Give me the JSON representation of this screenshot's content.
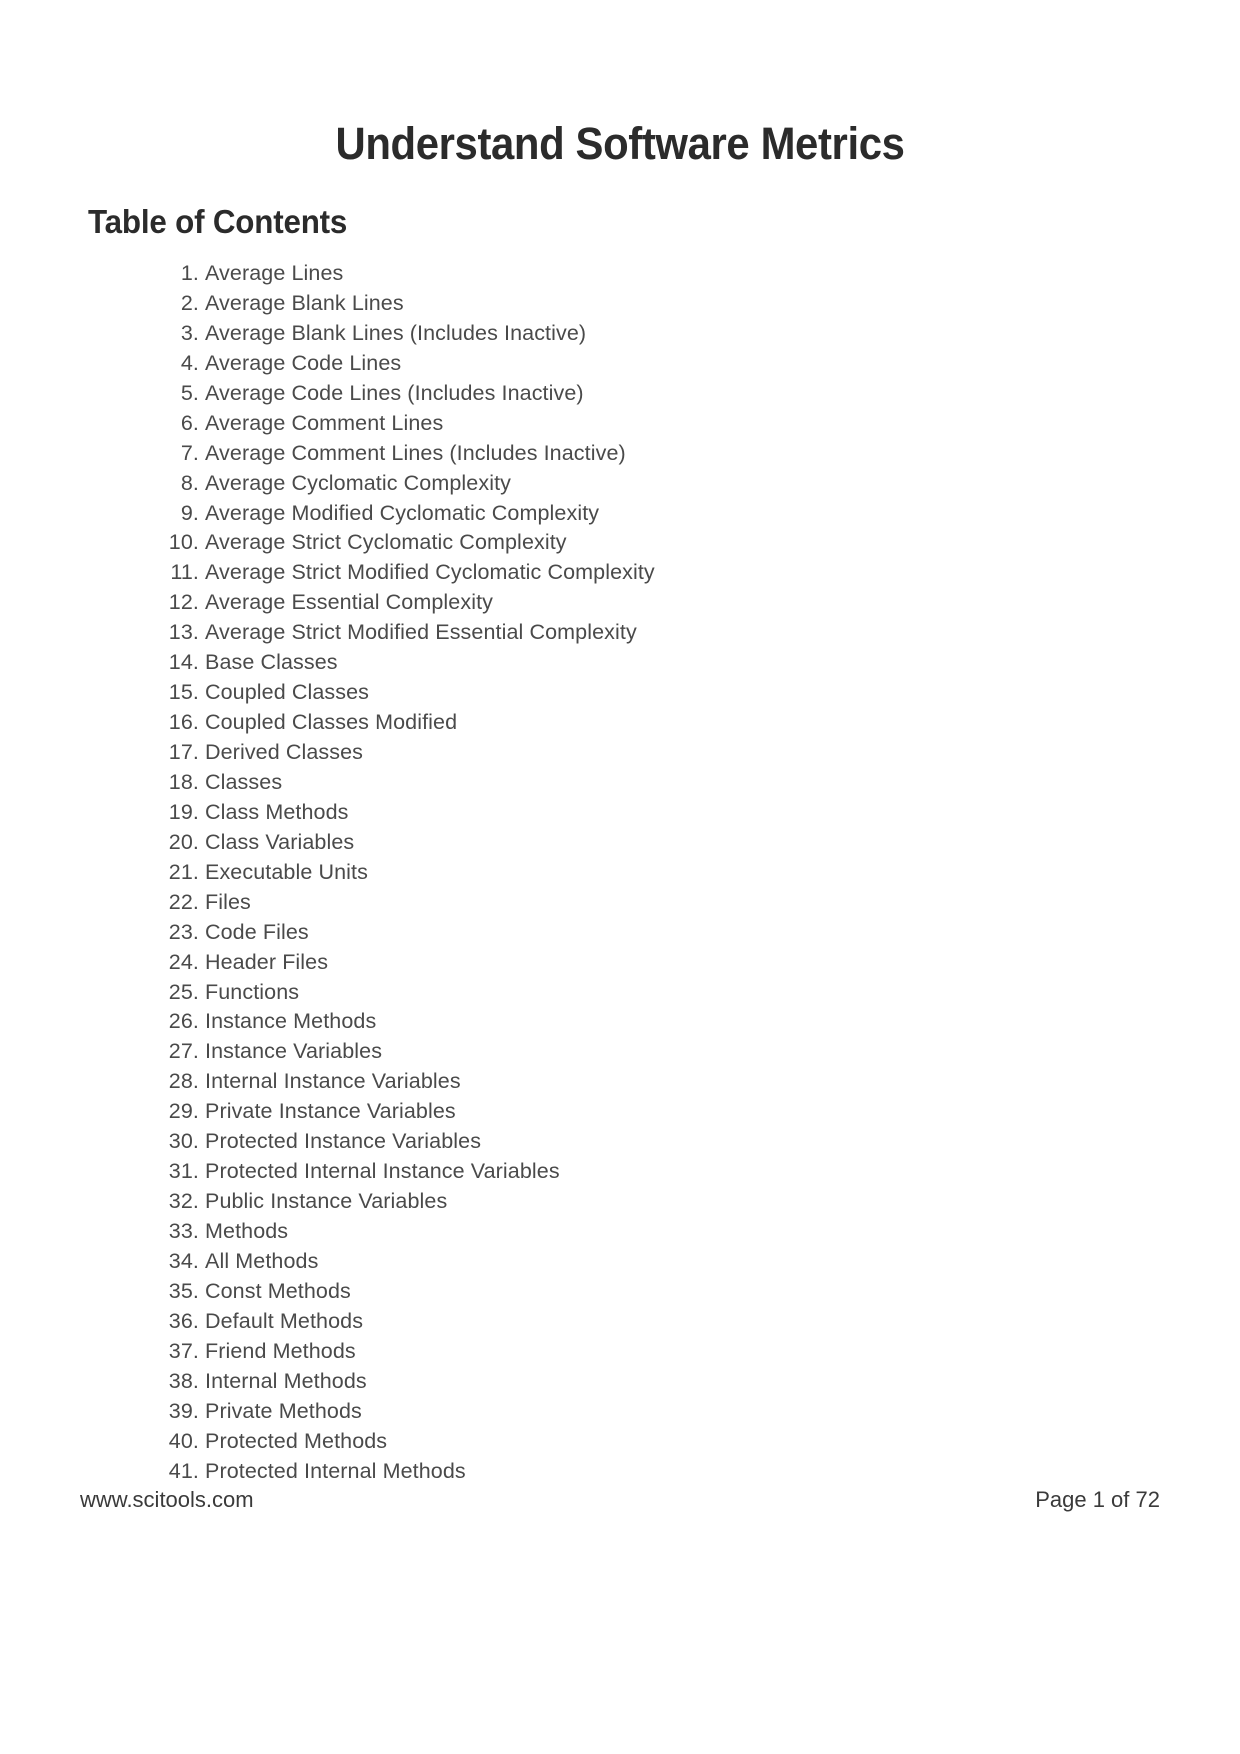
{
  "document": {
    "title": "Understand Software Metrics",
    "section_heading": "Table of Contents"
  },
  "toc": {
    "items": [
      {
        "number": "1.",
        "label": "Average Lines"
      },
      {
        "number": "2.",
        "label": "Average Blank Lines"
      },
      {
        "number": "3.",
        "label": "Average Blank Lines (Includes Inactive)"
      },
      {
        "number": "4.",
        "label": "Average Code Lines"
      },
      {
        "number": "5.",
        "label": "Average Code Lines (Includes Inactive)"
      },
      {
        "number": "6.",
        "label": "Average Comment Lines"
      },
      {
        "number": "7.",
        "label": "Average Comment Lines (Includes Inactive)"
      },
      {
        "number": "8.",
        "label": "Average Cyclomatic Complexity"
      },
      {
        "number": "9.",
        "label": "Average Modified Cyclomatic Complexity"
      },
      {
        "number": "10.",
        "label": "Average Strict Cyclomatic Complexity"
      },
      {
        "number": "11.",
        "label": "Average Strict Modified Cyclomatic Complexity"
      },
      {
        "number": "12.",
        "label": "Average Essential Complexity"
      },
      {
        "number": "13.",
        "label": "Average Strict Modified Essential Complexity"
      },
      {
        "number": "14.",
        "label": "Base Classes"
      },
      {
        "number": "15.",
        "label": "Coupled Classes"
      },
      {
        "number": "16.",
        "label": "Coupled Classes Modified"
      },
      {
        "number": "17.",
        "label": "Derived Classes"
      },
      {
        "number": "18.",
        "label": "Classes"
      },
      {
        "number": "19.",
        "label": "Class Methods"
      },
      {
        "number": "20.",
        "label": "Class Variables"
      },
      {
        "number": "21.",
        "label": "Executable Units"
      },
      {
        "number": "22.",
        "label": "Files"
      },
      {
        "number": "23.",
        "label": "Code Files"
      },
      {
        "number": "24.",
        "label": "Header Files"
      },
      {
        "number": "25.",
        "label": "Functions"
      },
      {
        "number": "26.",
        "label": "Instance Methods"
      },
      {
        "number": "27.",
        "label": "Instance Variables"
      },
      {
        "number": "28.",
        "label": "Internal Instance Variables"
      },
      {
        "number": "29.",
        "label": "Private Instance Variables"
      },
      {
        "number": "30.",
        "label": "Protected Instance Variables"
      },
      {
        "number": "31.",
        "label": "Protected Internal Instance Variables"
      },
      {
        "number": "32.",
        "label": "Public Instance Variables"
      },
      {
        "number": "33.",
        "label": "Methods"
      },
      {
        "number": "34.",
        "label": "All Methods"
      },
      {
        "number": "35.",
        "label": "Const Methods"
      },
      {
        "number": "36.",
        "label": "Default Methods"
      },
      {
        "number": "37.",
        "label": "Friend Methods"
      },
      {
        "number": "38.",
        "label": "Internal Methods"
      },
      {
        "number": "39.",
        "label": "Private Methods"
      },
      {
        "number": "40.",
        "label": "Protected Methods"
      },
      {
        "number": "41.",
        "label": "Protected Internal Methods"
      }
    ]
  },
  "footer": {
    "website": "www.scitools.com",
    "page_label": "Page 1 of 72"
  }
}
